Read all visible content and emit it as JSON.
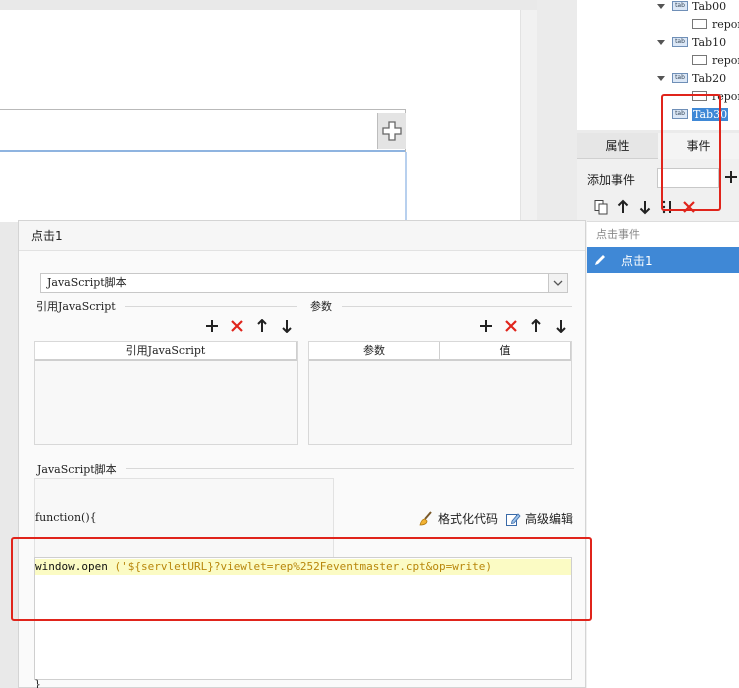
{
  "tree": {
    "items": [
      {
        "label": "Tab00",
        "child": "repor"
      },
      {
        "label": "Tab10",
        "child": "repor"
      },
      {
        "label": "Tab20",
        "child": "repor"
      },
      {
        "label": "Tab30",
        "selected": true
      }
    ]
  },
  "props": {
    "tabs": [
      "属性",
      "事件"
    ],
    "active_tab": "事件",
    "add_event_label": "添加事件",
    "event_list_header": "点击事件",
    "events": [
      "点击1"
    ]
  },
  "dialog": {
    "title": "点击1",
    "script_type": "JavaScript脚本",
    "ref_js_label": "引用JavaScript",
    "params_label": "参数",
    "ref_table_headers": [
      "引用JavaScript"
    ],
    "param_table_headers": [
      "参数",
      "值"
    ],
    "script_section_label": "JavaScript脚本",
    "function_header": "function(){",
    "format_code": "格式化代码",
    "advanced_edit": "高级编辑",
    "code_fn": "window.open",
    "code_str": " ('${servletURL}?viewlet=rep%252Feventmaster.cpt&op=write)",
    "closing_brace": "}"
  },
  "colors": {
    "accent": "#3f88d6",
    "highlight_red": "#e0241b",
    "code_line_bg": "#fbfbc4"
  }
}
